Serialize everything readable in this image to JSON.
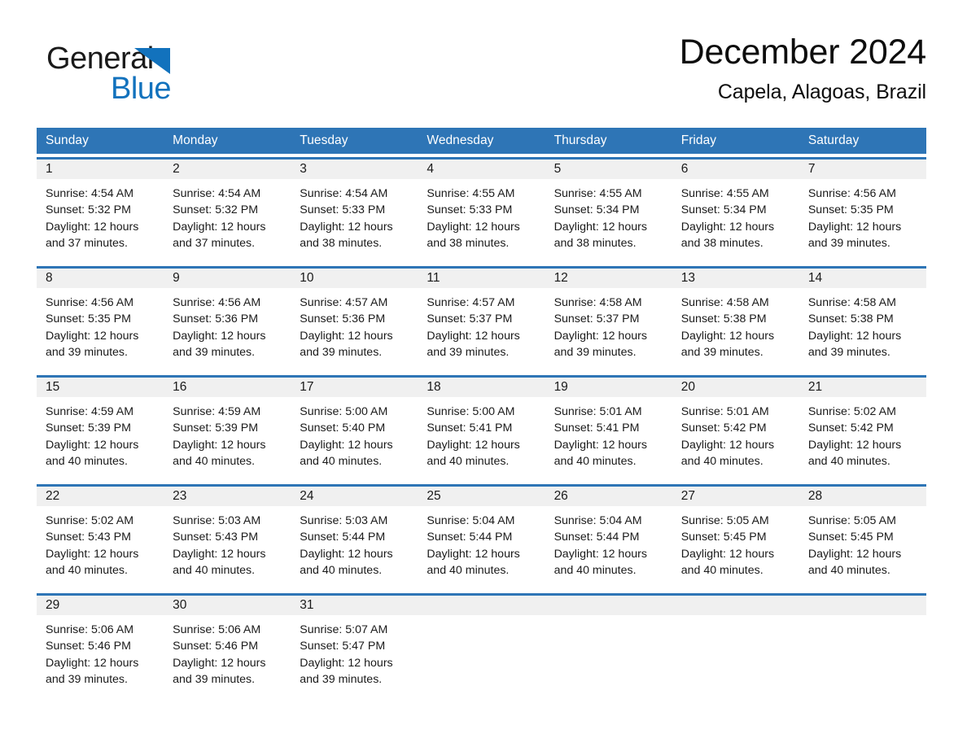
{
  "brand": {
    "word1": "General",
    "word2": "Blue",
    "accent_color": "#1272bd",
    "triangle_icon": "triangle-right-icon"
  },
  "header": {
    "month_title": "December 2024",
    "location": "Capela, Alagoas, Brazil"
  },
  "theme": {
    "header_blue": "#2e75b6",
    "date_strip_gray": "#f0f0f0",
    "text_color": "#1a1a1a"
  },
  "calendar": {
    "weekdays": [
      "Sunday",
      "Monday",
      "Tuesday",
      "Wednesday",
      "Thursday",
      "Friday",
      "Saturday"
    ],
    "weeks": [
      [
        {
          "day": "1",
          "sunrise": "Sunrise: 4:54 AM",
          "sunset": "Sunset: 5:32 PM",
          "daylight1": "Daylight: 12 hours",
          "daylight2": "and 37 minutes."
        },
        {
          "day": "2",
          "sunrise": "Sunrise: 4:54 AM",
          "sunset": "Sunset: 5:32 PM",
          "daylight1": "Daylight: 12 hours",
          "daylight2": "and 37 minutes."
        },
        {
          "day": "3",
          "sunrise": "Sunrise: 4:54 AM",
          "sunset": "Sunset: 5:33 PM",
          "daylight1": "Daylight: 12 hours",
          "daylight2": "and 38 minutes."
        },
        {
          "day": "4",
          "sunrise": "Sunrise: 4:55 AM",
          "sunset": "Sunset: 5:33 PM",
          "daylight1": "Daylight: 12 hours",
          "daylight2": "and 38 minutes."
        },
        {
          "day": "5",
          "sunrise": "Sunrise: 4:55 AM",
          "sunset": "Sunset: 5:34 PM",
          "daylight1": "Daylight: 12 hours",
          "daylight2": "and 38 minutes."
        },
        {
          "day": "6",
          "sunrise": "Sunrise: 4:55 AM",
          "sunset": "Sunset: 5:34 PM",
          "daylight1": "Daylight: 12 hours",
          "daylight2": "and 38 minutes."
        },
        {
          "day": "7",
          "sunrise": "Sunrise: 4:56 AM",
          "sunset": "Sunset: 5:35 PM",
          "daylight1": "Daylight: 12 hours",
          "daylight2": "and 39 minutes."
        }
      ],
      [
        {
          "day": "8",
          "sunrise": "Sunrise: 4:56 AM",
          "sunset": "Sunset: 5:35 PM",
          "daylight1": "Daylight: 12 hours",
          "daylight2": "and 39 minutes."
        },
        {
          "day": "9",
          "sunrise": "Sunrise: 4:56 AM",
          "sunset": "Sunset: 5:36 PM",
          "daylight1": "Daylight: 12 hours",
          "daylight2": "and 39 minutes."
        },
        {
          "day": "10",
          "sunrise": "Sunrise: 4:57 AM",
          "sunset": "Sunset: 5:36 PM",
          "daylight1": "Daylight: 12 hours",
          "daylight2": "and 39 minutes."
        },
        {
          "day": "11",
          "sunrise": "Sunrise: 4:57 AM",
          "sunset": "Sunset: 5:37 PM",
          "daylight1": "Daylight: 12 hours",
          "daylight2": "and 39 minutes."
        },
        {
          "day": "12",
          "sunrise": "Sunrise: 4:58 AM",
          "sunset": "Sunset: 5:37 PM",
          "daylight1": "Daylight: 12 hours",
          "daylight2": "and 39 minutes."
        },
        {
          "day": "13",
          "sunrise": "Sunrise: 4:58 AM",
          "sunset": "Sunset: 5:38 PM",
          "daylight1": "Daylight: 12 hours",
          "daylight2": "and 39 minutes."
        },
        {
          "day": "14",
          "sunrise": "Sunrise: 4:58 AM",
          "sunset": "Sunset: 5:38 PM",
          "daylight1": "Daylight: 12 hours",
          "daylight2": "and 39 minutes."
        }
      ],
      [
        {
          "day": "15",
          "sunrise": "Sunrise: 4:59 AM",
          "sunset": "Sunset: 5:39 PM",
          "daylight1": "Daylight: 12 hours",
          "daylight2": "and 40 minutes."
        },
        {
          "day": "16",
          "sunrise": "Sunrise: 4:59 AM",
          "sunset": "Sunset: 5:39 PM",
          "daylight1": "Daylight: 12 hours",
          "daylight2": "and 40 minutes."
        },
        {
          "day": "17",
          "sunrise": "Sunrise: 5:00 AM",
          "sunset": "Sunset: 5:40 PM",
          "daylight1": "Daylight: 12 hours",
          "daylight2": "and 40 minutes."
        },
        {
          "day": "18",
          "sunrise": "Sunrise: 5:00 AM",
          "sunset": "Sunset: 5:41 PM",
          "daylight1": "Daylight: 12 hours",
          "daylight2": "and 40 minutes."
        },
        {
          "day": "19",
          "sunrise": "Sunrise: 5:01 AM",
          "sunset": "Sunset: 5:41 PM",
          "daylight1": "Daylight: 12 hours",
          "daylight2": "and 40 minutes."
        },
        {
          "day": "20",
          "sunrise": "Sunrise: 5:01 AM",
          "sunset": "Sunset: 5:42 PM",
          "daylight1": "Daylight: 12 hours",
          "daylight2": "and 40 minutes."
        },
        {
          "day": "21",
          "sunrise": "Sunrise: 5:02 AM",
          "sunset": "Sunset: 5:42 PM",
          "daylight1": "Daylight: 12 hours",
          "daylight2": "and 40 minutes."
        }
      ],
      [
        {
          "day": "22",
          "sunrise": "Sunrise: 5:02 AM",
          "sunset": "Sunset: 5:43 PM",
          "daylight1": "Daylight: 12 hours",
          "daylight2": "and 40 minutes."
        },
        {
          "day": "23",
          "sunrise": "Sunrise: 5:03 AM",
          "sunset": "Sunset: 5:43 PM",
          "daylight1": "Daylight: 12 hours",
          "daylight2": "and 40 minutes."
        },
        {
          "day": "24",
          "sunrise": "Sunrise: 5:03 AM",
          "sunset": "Sunset: 5:44 PM",
          "daylight1": "Daylight: 12 hours",
          "daylight2": "and 40 minutes."
        },
        {
          "day": "25",
          "sunrise": "Sunrise: 5:04 AM",
          "sunset": "Sunset: 5:44 PM",
          "daylight1": "Daylight: 12 hours",
          "daylight2": "and 40 minutes."
        },
        {
          "day": "26",
          "sunrise": "Sunrise: 5:04 AM",
          "sunset": "Sunset: 5:44 PM",
          "daylight1": "Daylight: 12 hours",
          "daylight2": "and 40 minutes."
        },
        {
          "day": "27",
          "sunrise": "Sunrise: 5:05 AM",
          "sunset": "Sunset: 5:45 PM",
          "daylight1": "Daylight: 12 hours",
          "daylight2": "and 40 minutes."
        },
        {
          "day": "28",
          "sunrise": "Sunrise: 5:05 AM",
          "sunset": "Sunset: 5:45 PM",
          "daylight1": "Daylight: 12 hours",
          "daylight2": "and 40 minutes."
        }
      ],
      [
        {
          "day": "29",
          "sunrise": "Sunrise: 5:06 AM",
          "sunset": "Sunset: 5:46 PM",
          "daylight1": "Daylight: 12 hours",
          "daylight2": "and 39 minutes."
        },
        {
          "day": "30",
          "sunrise": "Sunrise: 5:06 AM",
          "sunset": "Sunset: 5:46 PM",
          "daylight1": "Daylight: 12 hours",
          "daylight2": "and 39 minutes."
        },
        {
          "day": "31",
          "sunrise": "Sunrise: 5:07 AM",
          "sunset": "Sunset: 5:47 PM",
          "daylight1": "Daylight: 12 hours",
          "daylight2": "and 39 minutes."
        },
        {
          "day": "",
          "sunrise": "",
          "sunset": "",
          "daylight1": "",
          "daylight2": ""
        },
        {
          "day": "",
          "sunrise": "",
          "sunset": "",
          "daylight1": "",
          "daylight2": ""
        },
        {
          "day": "",
          "sunrise": "",
          "sunset": "",
          "daylight1": "",
          "daylight2": ""
        },
        {
          "day": "",
          "sunrise": "",
          "sunset": "",
          "daylight1": "",
          "daylight2": ""
        }
      ]
    ]
  }
}
